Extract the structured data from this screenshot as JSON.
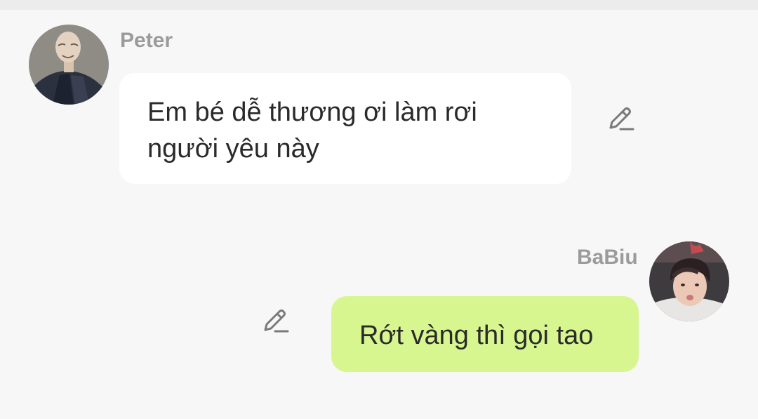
{
  "messages": [
    {
      "sender": "Peter",
      "direction": "incoming",
      "text": "Em bé dễ thương ơi làm rơi người yêu này",
      "bubble_color": "#ffffff",
      "avatar": "bald-man-avatar"
    },
    {
      "sender": "BaBiu",
      "direction": "outgoing",
      "text": "Rớt vàng thì gọi tao",
      "bubble_color": "#d7f68f",
      "avatar": "young-person-avatar"
    }
  ],
  "icons": {
    "edit": "pencil-edit-icon"
  },
  "colors": {
    "background": "#f7f7f7",
    "sender_name": "#9b9b9b",
    "message_text": "#2a2a2a",
    "icon": "#7a7a7a"
  }
}
